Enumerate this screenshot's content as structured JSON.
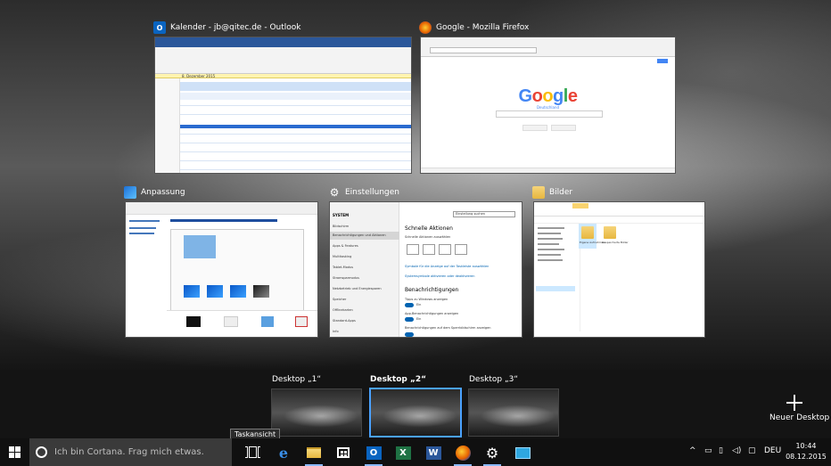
{
  "windows": {
    "outlook": {
      "title": "Kalender - jb@qitec.de - Outlook",
      "icon": "outlook-icon",
      "date_header": "8. Dezember 2015"
    },
    "firefox": {
      "title": "Google - Mozilla Firefox",
      "icon": "firefox-icon",
      "logo_text": "Google",
      "logo_sub": "Deutschland"
    },
    "anpassung": {
      "title": "Anpassung",
      "icon": "personalization-icon"
    },
    "einstellungen": {
      "title": "Einstellungen",
      "icon": "gear-icon",
      "section": "SYSTEM",
      "search_placeholder": "Einstellung suchen",
      "nav": [
        "Bildschirm",
        "Benachrichtigungen und Aktionen",
        "Apps & Features",
        "Multitasking",
        "Tablet-Modus",
        "Stromsparmodus",
        "Netzbetrieb und Energiesparen",
        "Speicher",
        "Offlinekarten",
        "Standard-Apps",
        "Info"
      ],
      "heading1": "Schnelle Aktionen",
      "sub1": "Schnelle Aktionen auswählen",
      "link1": "Symbole für die Anzeige auf der Taskleiste auswählen",
      "link2": "Systemsymbole aktivieren oder deaktivieren",
      "heading2": "Benachrichtigungen",
      "opt1": "Tipps zu Windows anzeigen",
      "opt2": "App-Benachrichtigungen anzeigen",
      "opt3": "Benachrichtigungen auf dem Sperrbildschirm anzeigen",
      "on": "Ein"
    },
    "bilder": {
      "title": "Bilder",
      "icon": "pictures-folder-icon",
      "folder1": "Eigene Aufnahmen",
      "folder2": "Gespeicherte Bilder"
    }
  },
  "desktops": [
    {
      "label": "Desktop „1“",
      "active": false
    },
    {
      "label": "Desktop „2“",
      "active": true
    },
    {
      "label": "Desktop „3“",
      "active": false
    }
  ],
  "new_desktop_label": "Neuer Desktop",
  "taskbar": {
    "search_placeholder": "Ich bin Cortana. Frag mich etwas.",
    "tooltip": "Taskansicht",
    "apps": [
      {
        "name": "edge-icon",
        "glyph": "e",
        "color": "#3a8ee6",
        "running": false
      },
      {
        "name": "file-explorer-icon",
        "glyph": "",
        "color": "#f3c44b",
        "running": true
      },
      {
        "name": "store-icon",
        "glyph": "",
        "color": "#ffffff",
        "running": false
      },
      {
        "name": "outlook-icon",
        "glyph": "O",
        "color": "#0a64c0",
        "running": true
      },
      {
        "name": "excel-icon",
        "glyph": "X",
        "color": "#1f7244",
        "running": false
      },
      {
        "name": "word-icon",
        "glyph": "W",
        "color": "#2b579a",
        "running": false
      },
      {
        "name": "firefox-icon",
        "glyph": "",
        "color": "#e66000",
        "running": true
      },
      {
        "name": "settings-icon",
        "glyph": "⚙",
        "color": "#ffffff",
        "running": true
      },
      {
        "name": "remote-desktop-icon",
        "glyph": "",
        "color": "#2fa7e0",
        "running": false
      }
    ],
    "language": "DEU",
    "time": "10:44",
    "date": "08.12.2015"
  }
}
